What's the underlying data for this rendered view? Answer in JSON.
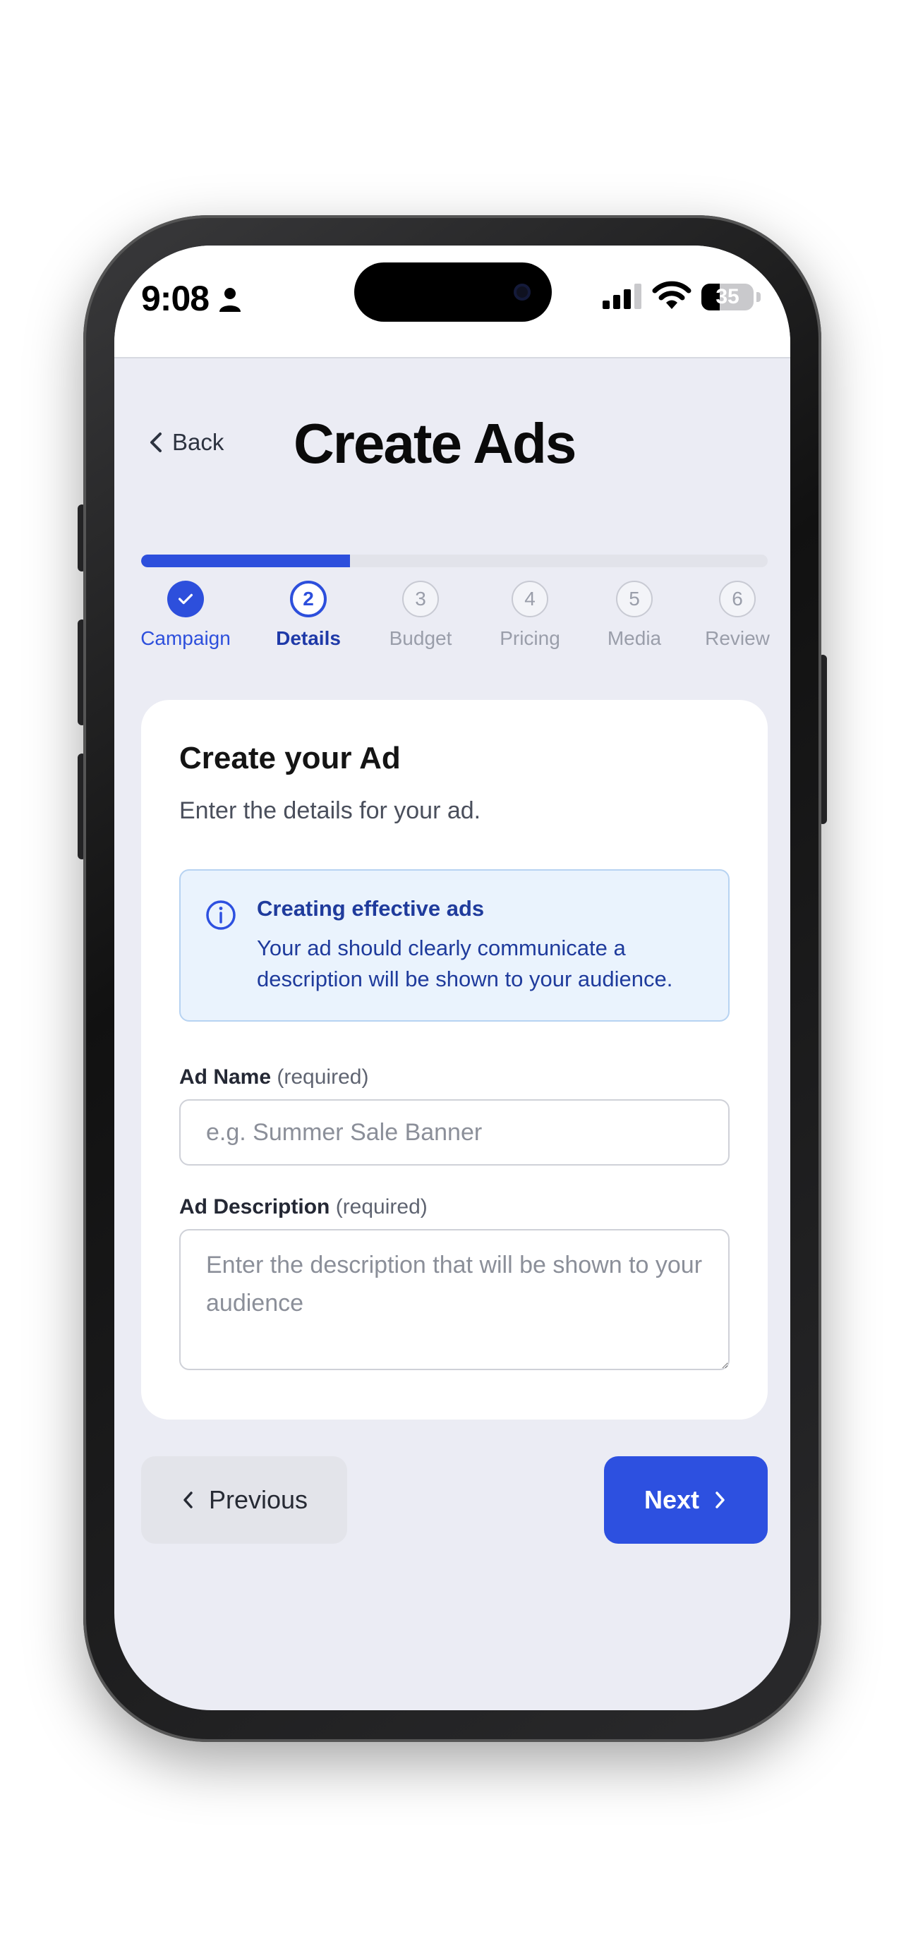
{
  "status_bar": {
    "time": "9:08",
    "battery_level": "35",
    "battery_fraction": 0.35
  },
  "header": {
    "back_label": "Back",
    "title": "Create Ads"
  },
  "progress": {
    "fraction": 0.333,
    "steps": [
      {
        "number": "",
        "label": "Campaign",
        "state": "done"
      },
      {
        "number": "2",
        "label": "Details",
        "state": "active"
      },
      {
        "number": "3",
        "label": "Budget",
        "state": "todo"
      },
      {
        "number": "4",
        "label": "Pricing",
        "state": "todo"
      },
      {
        "number": "5",
        "label": "Media",
        "state": "todo"
      },
      {
        "number": "6",
        "label": "Review",
        "state": "todo"
      }
    ]
  },
  "card": {
    "title": "Create your Ad",
    "subtitle": "Enter the details for your ad.",
    "info": {
      "title": "Creating effective ads",
      "text": "Your ad should clearly communicate a description will be shown to your audience."
    },
    "ad_name": {
      "label": "Ad Name",
      "required_text": "(required)",
      "value": "",
      "placeholder": "e.g. Summer Sale Banner"
    },
    "ad_description": {
      "label": "Ad Description",
      "required_text": "(required)",
      "value": "",
      "placeholder": "Enter the description that will be shown to your audience"
    }
  },
  "footer": {
    "previous_label": "Previous",
    "next_label": "Next"
  },
  "colors": {
    "accent": "#2d50e0",
    "info_bg": "#eaf3fd",
    "info_text": "#1f3b9c",
    "screen_bg": "#ebecf4"
  },
  "icons": {
    "back": "chevron-left-icon",
    "check": "check-icon",
    "info": "info-icon",
    "previous": "chevron-left-icon",
    "next": "chevron-right-icon"
  }
}
